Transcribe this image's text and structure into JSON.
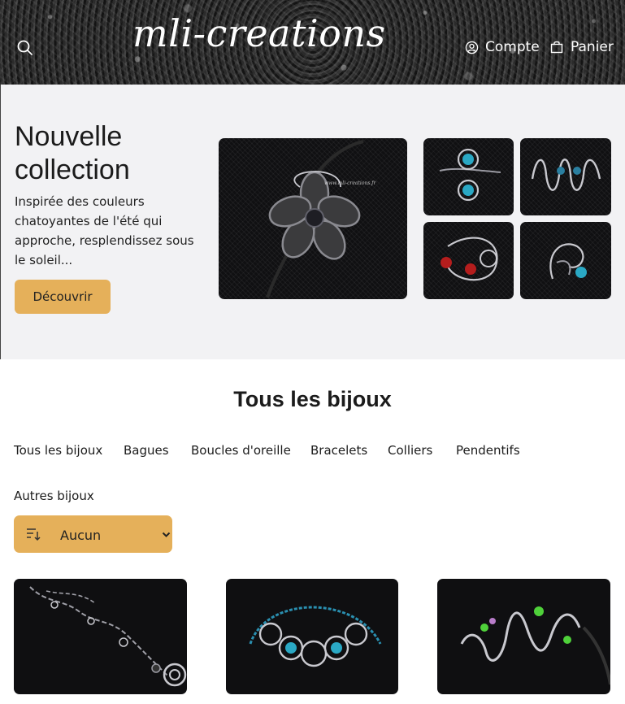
{
  "header": {
    "logo": "mli-creations",
    "account_label": "Compte",
    "cart_label": "Panier"
  },
  "hero": {
    "title": "Nouvelle collection",
    "description": "Inspirée des couleurs chatoyantes de l'été qui approche, resplendissez sous le soleil...",
    "cta_label": "Découvrir",
    "watermark": "www.mli-creations.fr"
  },
  "section": {
    "title": "Tous les bijoux",
    "categories": [
      "Tous les bijoux",
      "Bagues",
      "Boucles d'oreille",
      "Bracelets",
      "Colliers",
      "Pendentifs",
      "Autres bijoux"
    ],
    "sort": {
      "selected": "Aucun"
    }
  },
  "colors": {
    "accent": "#e5b05a",
    "hero_bg": "#f2f2f4",
    "text": "#1b1b1b"
  },
  "icons": [
    "search-icon",
    "account-icon",
    "cart-icon",
    "sort-icon",
    "chevron-down-icon"
  ]
}
